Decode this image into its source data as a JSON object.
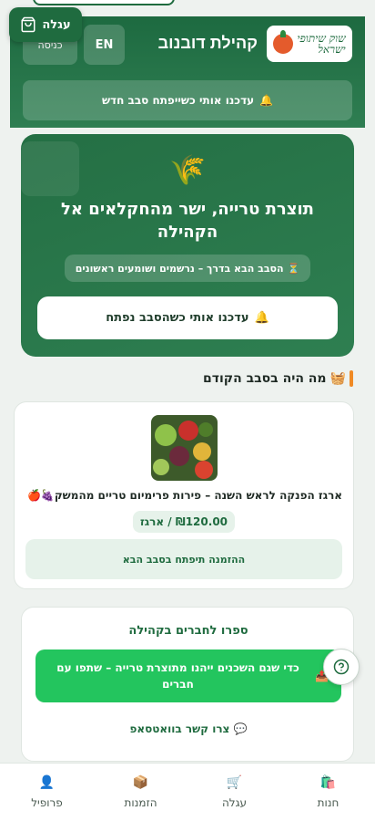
{
  "header": {
    "community_title": "קהילת דובנוב",
    "logo_text_line1": "שוק שיתופי",
    "logo_text_line2": "ישראל",
    "lang_button": "EN",
    "login_button": "כניסה",
    "notify_banner": "עדכנו אותי כשייפתח סבב חדש",
    "cart_label": "עגלה"
  },
  "hero": {
    "icon": "🌾",
    "title": "תוצרת טרייה, ישר מהחקלאים אל הקהילה",
    "status": "הסבב הבא בדרך – נרשמים ושומעים ראשונים",
    "status_icon": "⏳",
    "notify_button": "עדכנו אותי כשהסבב נפתח",
    "notify_icon": "🔔"
  },
  "previous_round": {
    "section_title": "מה היה בסבב הקודם",
    "section_icon": "🧺",
    "product_name": "ארגז הפנקה לראש השנה – פירות פרימיום טריים מהמשק🍇🍎",
    "price": "₪120.00 / ארגז",
    "next_order_note": "ההזמנה תיפתח בסבב הבא"
  },
  "share": {
    "title": "ספרו לחברים בקהילה",
    "share_button": "כדי שגם השכנים ייהנו מתוצרת טרייה – שתפו עם חברים",
    "share_icon": "📤",
    "whatsapp_link": "צרו קשר בוואטסאפ",
    "whatsapp_icon": "💬"
  },
  "help_button": "?",
  "bottom_nav": {
    "items": [
      {
        "label": "חנות",
        "icon": "🛍️"
      },
      {
        "label": "עגלה",
        "icon": "🛒"
      },
      {
        "label": "הזמנות",
        "icon": "📦"
      },
      {
        "label": "פרופיל",
        "icon": "👤"
      }
    ]
  },
  "colors": {
    "primary_green": "#1f6b3f",
    "whatsapp_green": "#23c55e",
    "accent_orange": "#f08a24"
  }
}
